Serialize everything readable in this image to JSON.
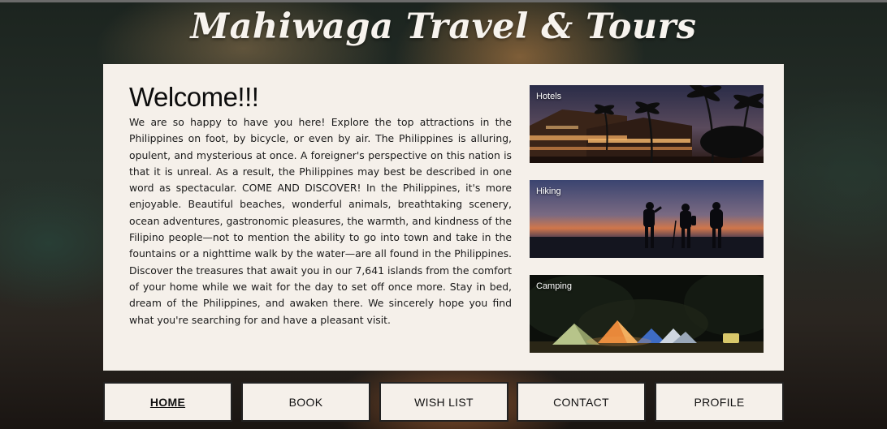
{
  "site": {
    "title": "Mahiwaga Travel & Tours"
  },
  "welcome": {
    "heading": "Welcome!!!",
    "body": "We are so happy to have you here! Explore the top attractions in the Philippines on foot, by bicycle, or even by air. The Philippines is alluring, opulent, and mysterious at once. A foreigner's perspective on this nation is that it is unreal. As a result, the Philippines may best be described in one word as spectacular. COME AND DISCOVER! In the Philippines, it's more enjoyable. Beautiful beaches, wonderful animals, breathtaking scenery, ocean adventures, gastronomic pleasures, the warmth, and kindness of the Filipino people—not to mention the ability to go into town and take in the fountains or a nighttime walk by the water—are all found in the Philippines. Discover the treasures that await you in our 7,641 islands from the comfort of your home while we wait for the day to set off once more. Stay in bed, dream of the Philippines, and awaken there. We sincerely hope you find what you're searching for and have a pleasant visit."
  },
  "cards": [
    {
      "label": "Hotels",
      "image": "resort-at-dusk-with-palm-trees"
    },
    {
      "label": "Hiking",
      "image": "hikers-silhouetted-at-sunset"
    },
    {
      "label": "Camping",
      "image": "tents-lit-at-night-in-forest"
    }
  ],
  "nav": {
    "items": [
      {
        "label": "HOME",
        "active": true
      },
      {
        "label": "BOOK",
        "active": false
      },
      {
        "label": "WISH LIST",
        "active": false
      },
      {
        "label": "CONTACT",
        "active": false
      },
      {
        "label": "PROFILE",
        "active": false
      }
    ]
  },
  "colors": {
    "panel_background": "#f5f0ea",
    "title_text": "#f7f3ee",
    "body_text": "#1a1a1a",
    "nav_border": "#222222"
  }
}
